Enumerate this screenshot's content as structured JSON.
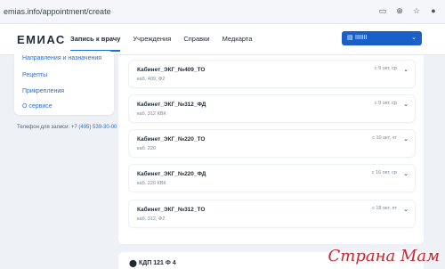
{
  "browser": {
    "url": "emias.info/appointment/create"
  },
  "header": {
    "logo": "ЕМИАС",
    "nav": [
      "Запись к врачу",
      "Учреждения",
      "Справки",
      "Медкарта"
    ],
    "user_name": "IIIIIII"
  },
  "side_menu": {
    "items": [
      "Направления и назначения",
      "Рецепты",
      "Прикрепления",
      "О сервисе"
    ],
    "phone_label": "Телефон для записи:",
    "phone": "+7 (495) 539-30-00"
  },
  "rooms": [
    {
      "name": "Кабинет_ЭКГ_№409_ТО",
      "sub": "каб. 409, Ф2",
      "date": "с 9 окт, ср"
    },
    {
      "name": "Кабинет_ЭКГ_№312_ФД",
      "sub": "каб. 312 КВК",
      "date": "с 9 окт, ср"
    },
    {
      "name": "Кабинет_ЭКГ_№220_ТО",
      "sub": "каб. 220",
      "date": "с 10 окт, чт"
    },
    {
      "name": "Кабинет_ЭКГ_№220_ФД",
      "sub": "каб. 220 КВК",
      "date": "с 16 окт, ср"
    },
    {
      "name": "Кабинет_ЭКГ_№312_ТО",
      "sub": "каб. 312, Ф2",
      "date": "с 18 окт, пт"
    }
  ],
  "location": {
    "address": "КДП 121 Ф 4"
  },
  "watermark": "Страна Мам"
}
